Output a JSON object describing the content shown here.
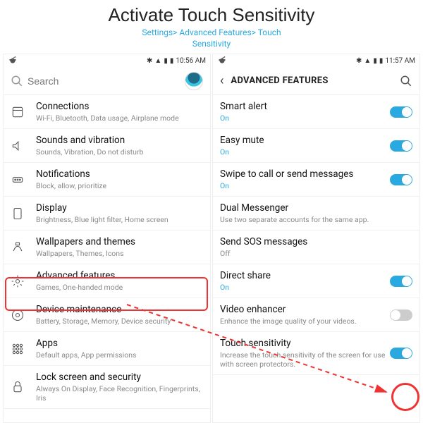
{
  "header": {
    "title": "Activate Touch Sensitivity",
    "breadcrumb1": "Settings> Advanced Features> Touch",
    "breadcrumb2": "Sensitivity"
  },
  "left": {
    "status_time": "10:56 AM",
    "search_placeholder": "Search",
    "items": [
      {
        "label": "Connections",
        "sub": "Wi-Fi, Bluetooth, Data usage, Airplane mode"
      },
      {
        "label": "Sounds and vibration",
        "sub": "Sounds, Vibration, Do not disturb"
      },
      {
        "label": "Notifications",
        "sub": "Block, allow, prioritize"
      },
      {
        "label": "Display",
        "sub": "Brightness, Blue light filter, Home screen"
      },
      {
        "label": "Wallpapers and themes",
        "sub": "Wallpapers, Themes, Icons"
      },
      {
        "label": "Advanced features",
        "sub": "Games, One-handed mode"
      },
      {
        "label": "Device maintenance",
        "sub": "Battery, Storage, Memory, Device security"
      },
      {
        "label": "Apps",
        "sub": "Default apps, App permissions"
      },
      {
        "label": "Lock screen and security",
        "sub": "Always On Display, Face Recognition, Fingerprints, Iris"
      }
    ]
  },
  "right": {
    "status_time": "11:57 AM",
    "title": "ADVANCED FEATURES",
    "items": [
      {
        "label": "Smart alert",
        "sub": "On",
        "toggle": true,
        "on": true
      },
      {
        "label": "Easy mute",
        "sub": "On",
        "toggle": true,
        "on": true
      },
      {
        "label": "Swipe to call or send messages",
        "sub": "On",
        "toggle": true,
        "on": true
      },
      {
        "label": "Dual Messenger",
        "sub": "Use two separate accounts for the same app.",
        "toggle": false
      },
      {
        "label": "Send SOS messages",
        "sub": "Off",
        "toggle": false
      },
      {
        "label": "Direct share",
        "sub": "On",
        "toggle": true,
        "on": true
      },
      {
        "label": "Video enhancer",
        "sub": "Enhance the image quality of your videos.",
        "toggle": true,
        "on": false
      },
      {
        "label": "Touch sensitivity",
        "sub": "Increase the touch sensitivity of the screen for use with screen protectors.",
        "toggle": true,
        "on": true
      }
    ]
  }
}
